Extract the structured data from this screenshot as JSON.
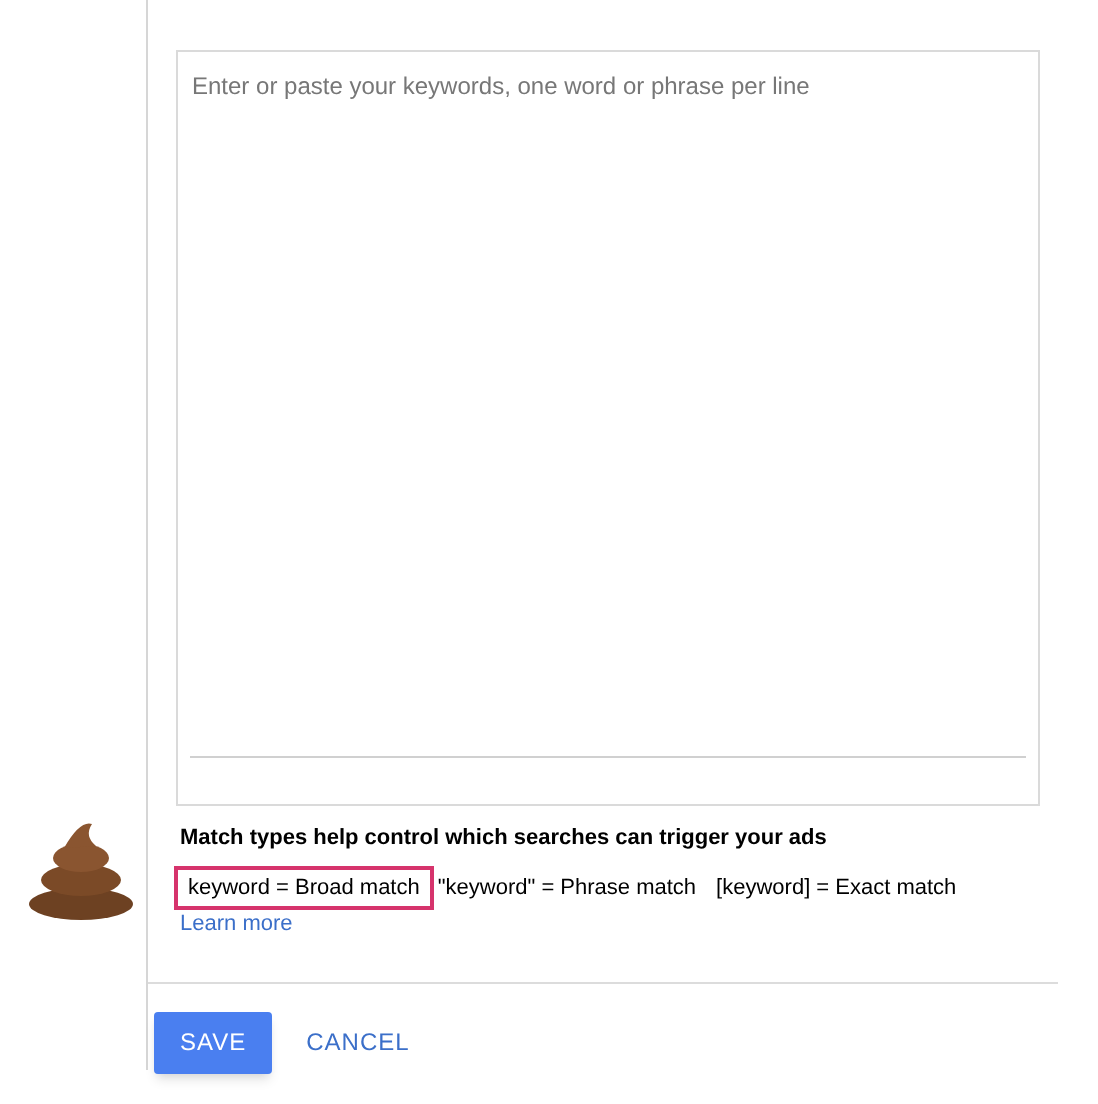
{
  "keywords_field": {
    "placeholder": "Enter or paste your keywords, one word or phrase per line"
  },
  "match_types": {
    "heading": "Match types help control which searches can trigger your ads",
    "items": [
      {
        "label": "keyword = Broad match",
        "highlighted": true
      },
      {
        "label": "\"keyword\" = Phrase match",
        "highlighted": false
      },
      {
        "label": "[keyword] = Exact match",
        "highlighted": false
      }
    ],
    "link": "Learn more"
  },
  "buttons": [
    {
      "label": "SAVE",
      "kind": "primary"
    },
    {
      "label": "CANCEL",
      "kind": "text"
    }
  ]
}
